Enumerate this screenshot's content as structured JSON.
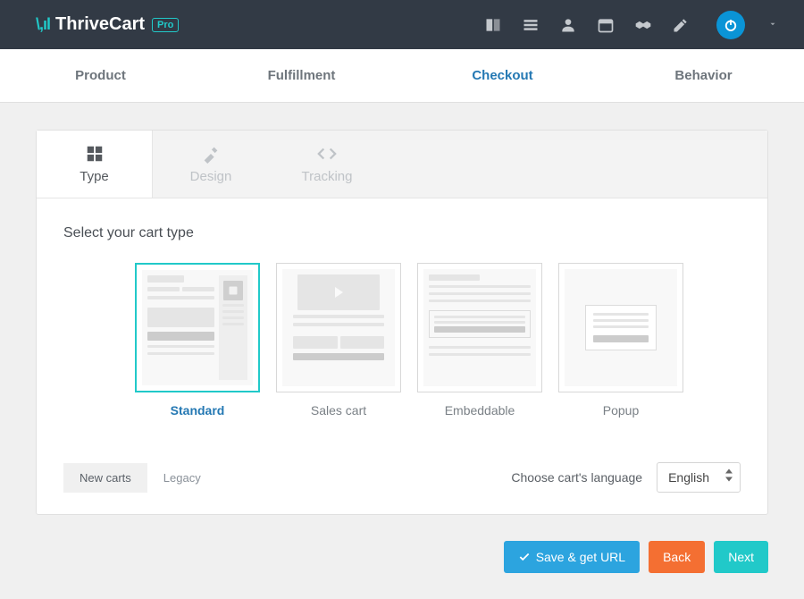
{
  "brand": {
    "name": "ThriveCart",
    "badge": "Pro"
  },
  "mainTabs": [
    "Product",
    "Fulfillment",
    "Checkout",
    "Behavior"
  ],
  "activeMainTab": 2,
  "subTabs": [
    "Type",
    "Design",
    "Tracking"
  ],
  "activeSubTab": 0,
  "sectionTitle": "Select your cart type",
  "cartTypes": [
    "Standard",
    "Sales cart",
    "Embeddable",
    "Popup"
  ],
  "selectedCartType": 0,
  "versionTabs": [
    "New carts",
    "Legacy"
  ],
  "activeVersionTab": 0,
  "languageLabel": "Choose cart's language",
  "languageValue": "English",
  "actions": {
    "save": "Save & get URL",
    "back": "Back",
    "next": "Next"
  },
  "colors": {
    "accent": "#21c9c9",
    "link": "#2478b3",
    "topbar": "#323a45",
    "warn": "#f46f32",
    "primary": "#2ca4df"
  }
}
